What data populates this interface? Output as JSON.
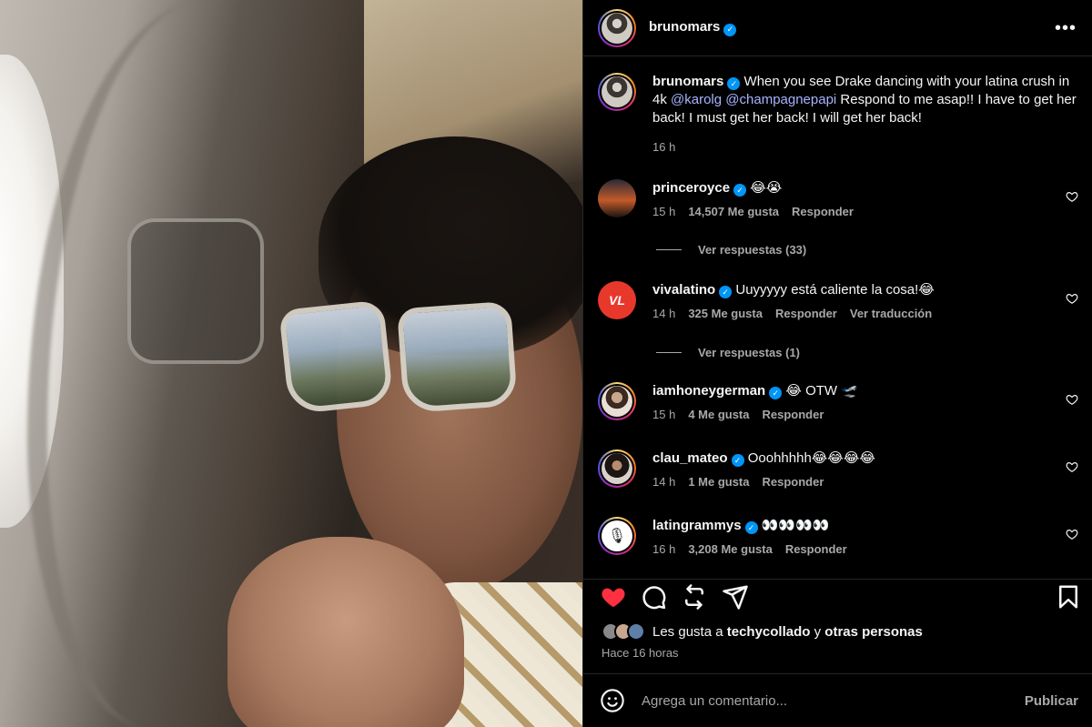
{
  "post": {
    "author": "brunomars",
    "more_icon": "more-horizontal-icon"
  },
  "caption": {
    "username": "brunomars",
    "text_before": "When you see Drake dancing with your latina crush in 4k ",
    "mention1": "@karolg",
    "mention2": "@champagnepapi",
    "text_after": " Respond to me asap!! I have to get her back! I must get her back! I will get her back!",
    "time": "16 h"
  },
  "comments": [
    {
      "username": "princeroyce",
      "text": "😂😭",
      "time": "15 h",
      "likes": "14,507 Me gusta",
      "reply": "Responder",
      "replies": "Ver respuestas (33)"
    },
    {
      "username": "vivalatino",
      "text": "Uuyyyyy está caliente la cosa!😂",
      "time": "14 h",
      "likes": "325 Me gusta",
      "reply": "Responder",
      "translate": "Ver traducción",
      "replies": "Ver respuestas (1)"
    },
    {
      "username": "iamhoneygerman",
      "text": "😂 OTW 🛫",
      "time": "15 h",
      "likes": "4 Me gusta",
      "reply": "Responder"
    },
    {
      "username": "clau_mateo",
      "text": "Ooohhhhh😂😂😂😂",
      "time": "14 h",
      "likes": "1 Me gusta",
      "reply": "Responder"
    },
    {
      "username": "latingrammys",
      "text": "👀👀👀👀",
      "time": "16 h",
      "likes": "3,208 Me gusta",
      "reply": "Responder"
    }
  ],
  "actions": {
    "like_icon": "heart-filled-icon",
    "comment_icon": "comment-icon",
    "repost_icon": "repost-icon",
    "share_icon": "send-icon",
    "save_icon": "bookmark-icon",
    "like_color": "#ff3040"
  },
  "likes": {
    "prefix": "Les gusta a ",
    "user": "techycollado",
    "middle": " y ",
    "others": "otras personas"
  },
  "posted_ago": "Hace 16 horas",
  "comment_box": {
    "placeholder": "Agrega un comentario...",
    "publish": "Publicar",
    "emoji_icon": "smiley-icon"
  },
  "colors": {
    "background": "#000000",
    "verified": "#0095f6",
    "mention": "#a8b3ff",
    "secondary_text": "#a8a8a8"
  }
}
